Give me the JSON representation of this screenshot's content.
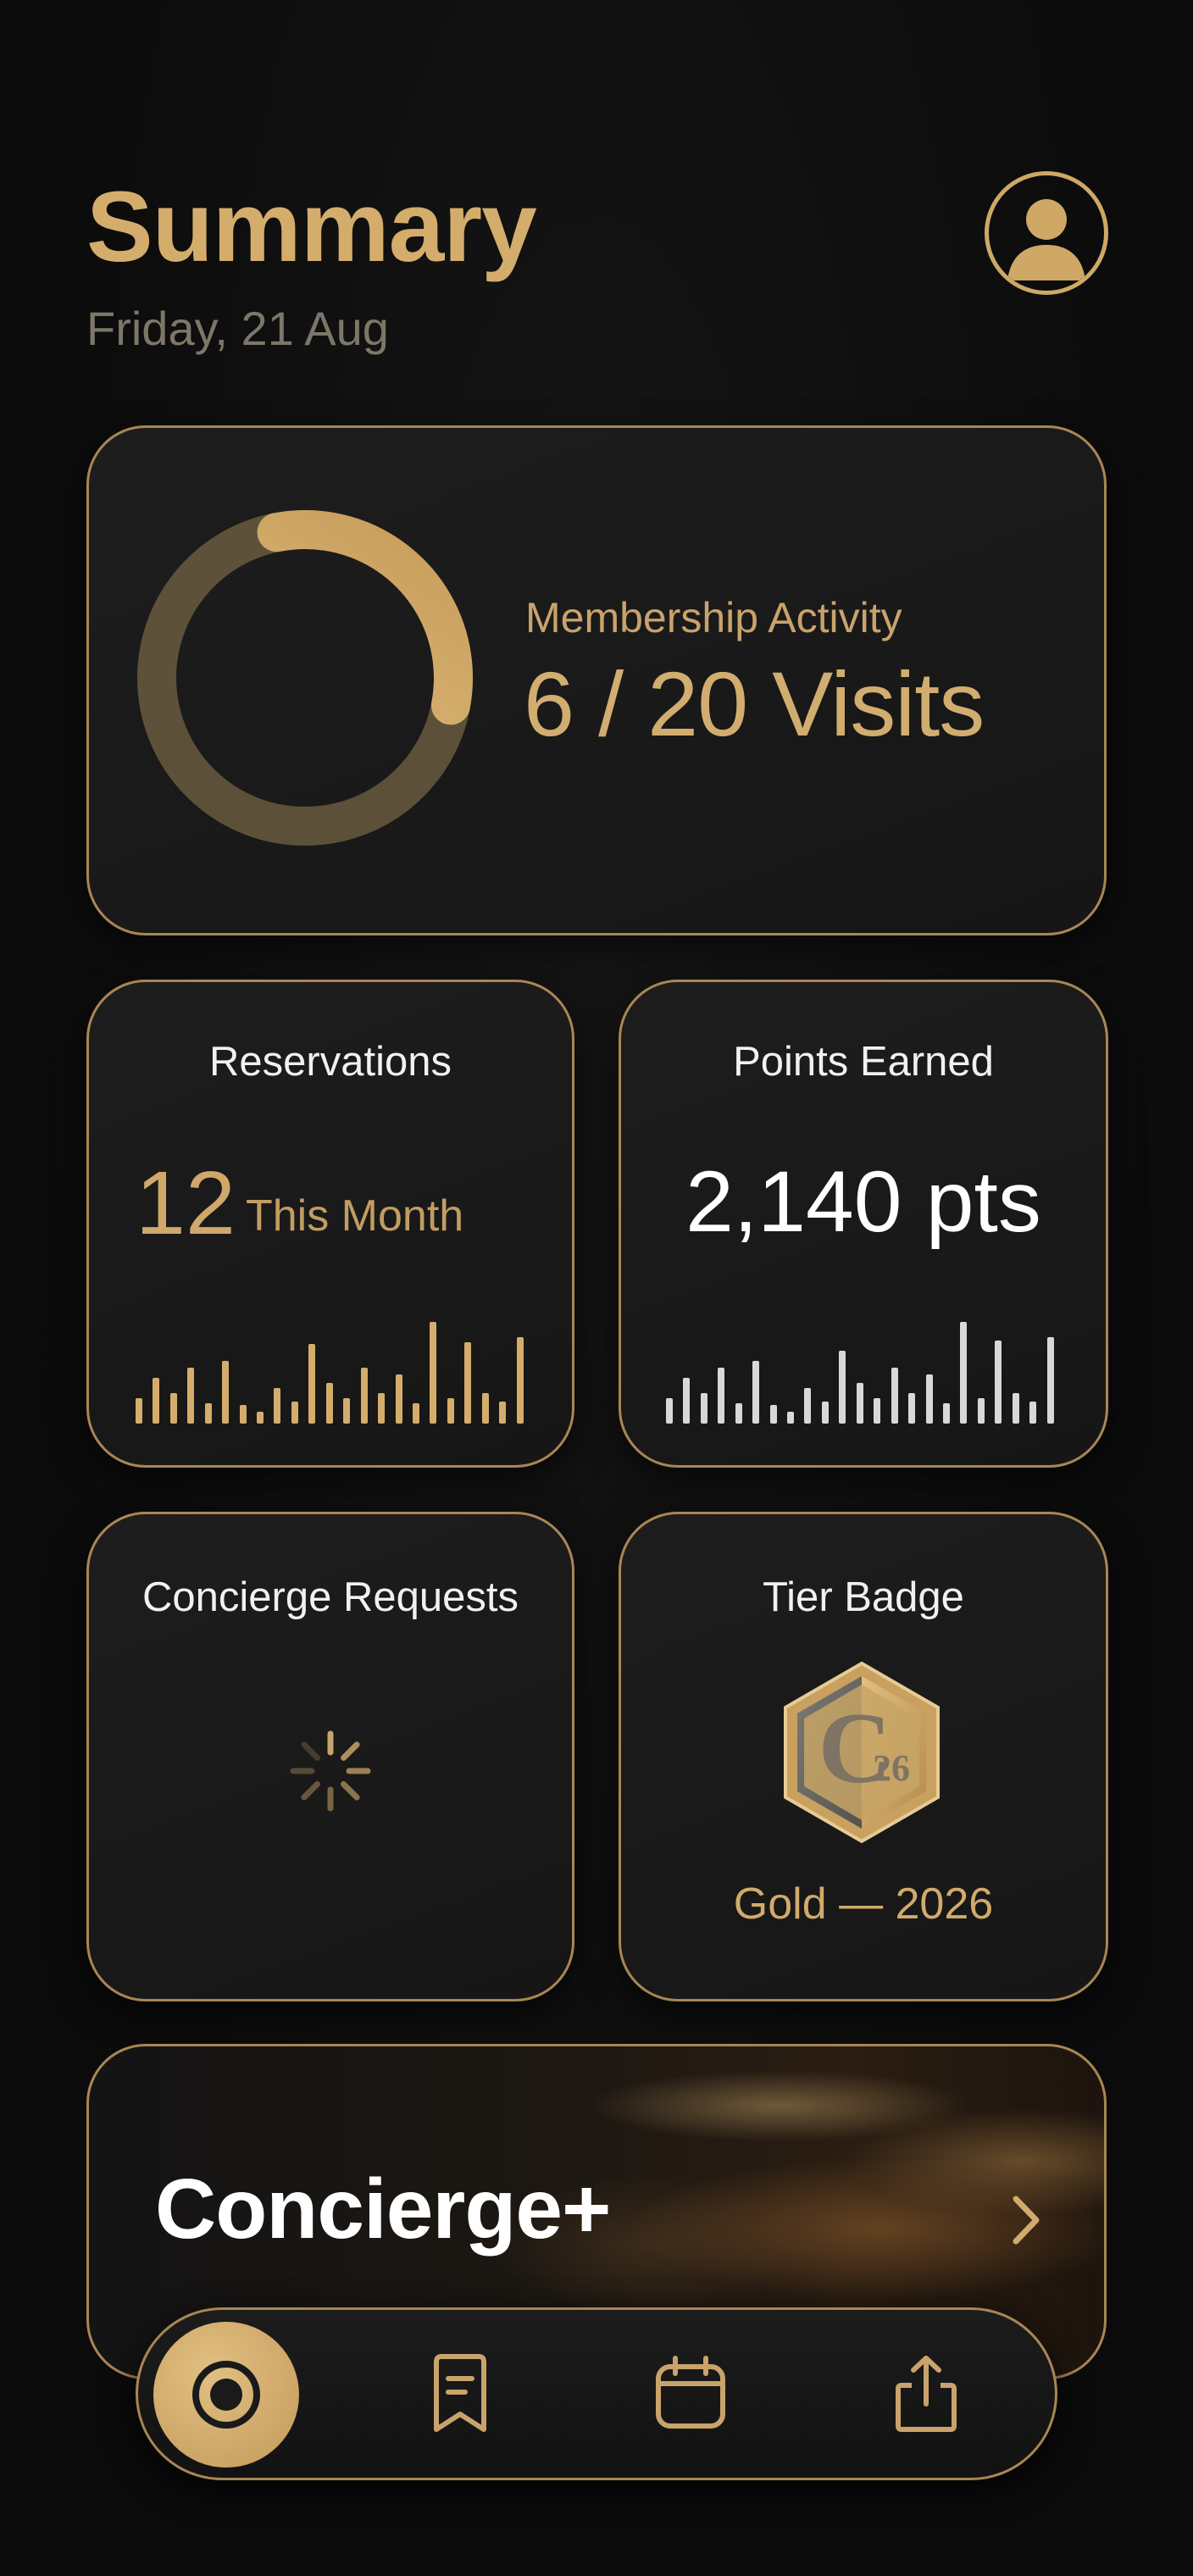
{
  "header": {
    "title": "Summary",
    "date": "Friday, 21 Aug"
  },
  "membership": {
    "label": "Membership Activity",
    "value_text": "6 / 20 Visits",
    "visits": 6,
    "visits_total": 20,
    "ring_progress_visible": 0.31
  },
  "reservations": {
    "label": "Reservations",
    "count": "12",
    "unit": "This Month",
    "bar_levels": [
      0.25,
      0.45,
      0.3,
      0.55,
      0.2,
      0.62,
      0.18,
      0.12,
      0.35,
      0.22,
      0.78,
      0.4,
      0.25,
      0.55,
      0.3,
      0.48,
      0.2,
      1.0,
      0.25,
      0.8,
      0.3,
      0.22,
      0.85
    ]
  },
  "points": {
    "label": "Points Earned",
    "value_text": "2,140 pts",
    "bar_levels": [
      0.25,
      0.45,
      0.3,
      0.55,
      0.2,
      0.62,
      0.18,
      0.12,
      0.35,
      0.22,
      0.72,
      0.4,
      0.25,
      0.55,
      0.3,
      0.48,
      0.2,
      1.0,
      0.25,
      0.82,
      0.3,
      0.22,
      0.85
    ]
  },
  "concierge_requests": {
    "label": "Concierge Requests"
  },
  "tier": {
    "label": "Tier Badge",
    "badge_mark": "C",
    "badge_year": "26",
    "value_text": "Gold — 2026"
  },
  "promo": {
    "title": "Concierge+"
  },
  "tabbar": {
    "tabs": [
      {
        "icon": "record-icon",
        "active": true
      },
      {
        "icon": "bookmark-note-icon",
        "active": false
      },
      {
        "icon": "calendar-icon",
        "active": false
      },
      {
        "icon": "share-icon",
        "active": false
      }
    ]
  },
  "colors": {
    "accent_gold": "#d4ad6c",
    "background": "#0c0c0c",
    "card_border": "#a88654",
    "bars_neutral": "#d8d8d8"
  }
}
